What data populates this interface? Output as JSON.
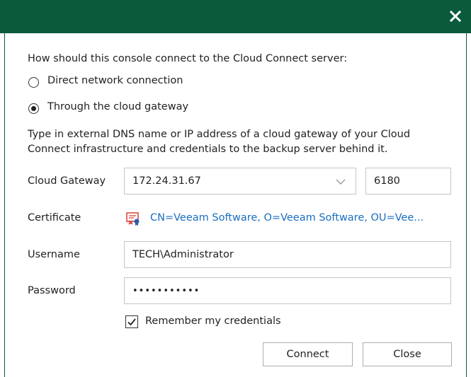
{
  "dialog": {
    "close_glyph": "×",
    "prompt": "How should this console connect to the Cloud Connect server:",
    "options": [
      {
        "label": "Direct network connection",
        "selected": false
      },
      {
        "label": "Through the cloud gateway",
        "selected": true
      }
    ],
    "description_line1": "Type in external DNS name or IP address of a cloud gateway of your Cloud",
    "description_line2": "Connect infrastructure and credentials to the backup server behind it.",
    "gateway": {
      "label": "Cloud Gateway",
      "address": "172.24.31.67",
      "port": "6180"
    },
    "certificate": {
      "label": "Certificate",
      "icon": "certificate-error-icon",
      "value": "CN=Veeam Software, O=Veeam Software, OU=Vee..."
    },
    "username": {
      "label": "Username",
      "value": "TECH\\Administrator"
    },
    "password": {
      "label": "Password",
      "masked_value": "•••••••••••"
    },
    "remember": {
      "label": "Remember my credentials",
      "checked": true
    },
    "buttons": {
      "connect": "Connect",
      "close": "Close"
    },
    "colors": {
      "titlebar": "#0a5a3c",
      "link": "#1a6fbe",
      "cert_icon_red": "#d9342b"
    }
  }
}
